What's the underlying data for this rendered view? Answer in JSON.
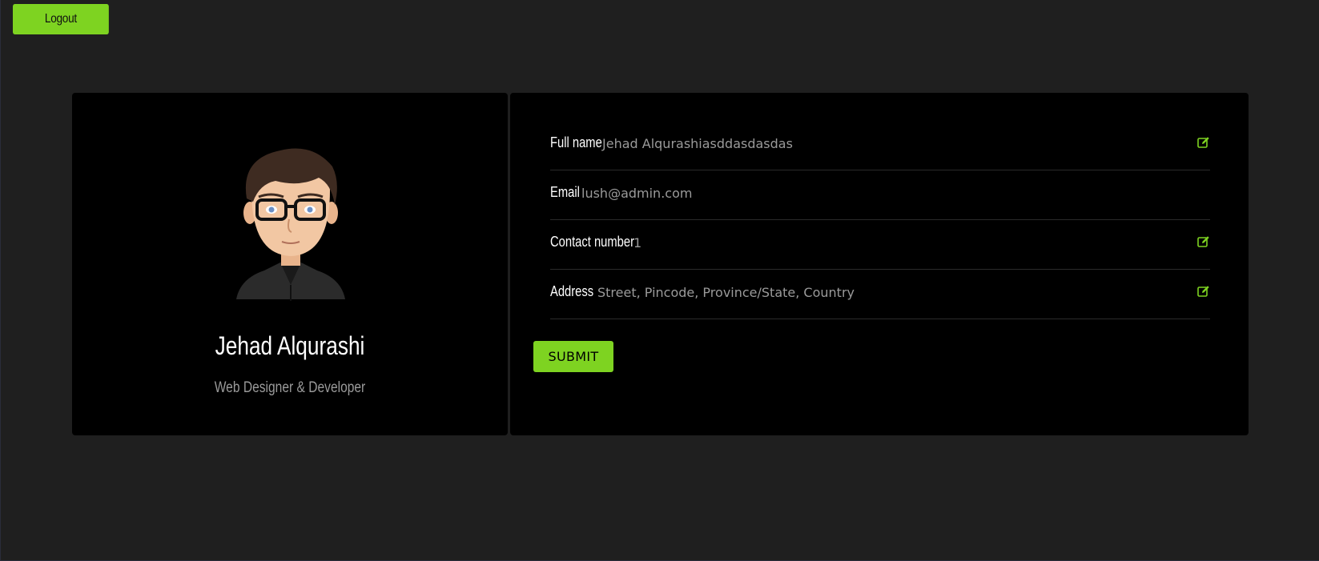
{
  "header": {
    "logout_label": "Logout"
  },
  "profile": {
    "name": "Jehad Alqurashi",
    "role": "Web Designer & Developer",
    "avatar_icon": "person-avatar"
  },
  "details": {
    "full_name": {
      "label": "Full name",
      "value": "Jehad Alqurashiasddasdasdas",
      "editable": true
    },
    "email": {
      "label": "Email",
      "value": "lush@admin.com",
      "editable": false
    },
    "contact": {
      "label": "Contact number",
      "value": "1",
      "editable": true
    },
    "address": {
      "label": "Address",
      "value": "Street, Pincode, Province/State, Country",
      "editable": true
    },
    "submit_label": "SUBMIT"
  },
  "colors": {
    "accent": "#7ed321",
    "background": "#1f1f1f",
    "card": "#000000",
    "muted_text": "#9a9a9a"
  }
}
